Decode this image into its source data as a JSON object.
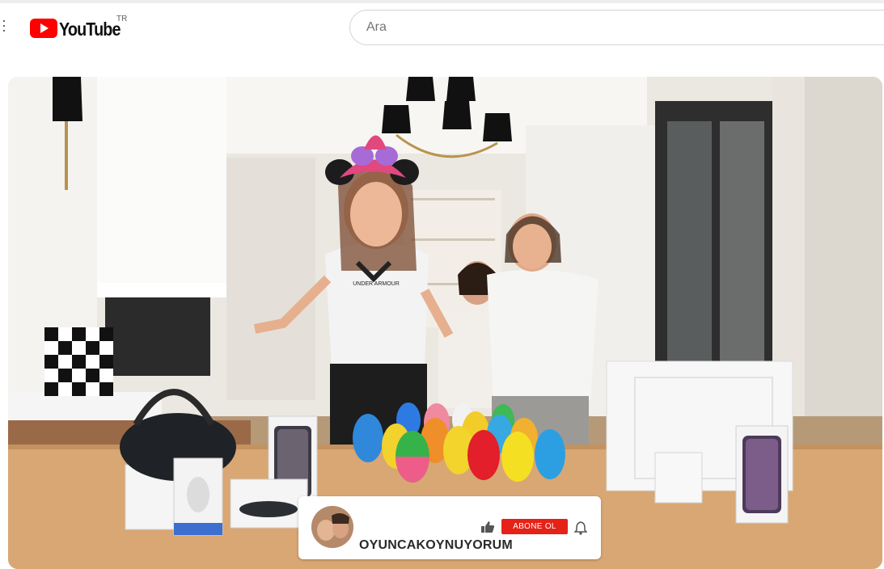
{
  "header": {
    "logo_text": "YouTube",
    "country_code": "TR",
    "search_placeholder": "Ara"
  },
  "video_overlay": {
    "channel_name": "OYUNCAKOYNUYORUM",
    "subscribe_label": "ABONE OL",
    "shirt_brand_text": "UNDER ARMOUR",
    "subscribe_color": "#e62117"
  },
  "icons": [
    "menu-icon",
    "youtube-logo-icon",
    "like-icon",
    "bell-icon"
  ],
  "colors": {
    "brand_red": "#ff0000",
    "page_bg": "#ffffff"
  }
}
